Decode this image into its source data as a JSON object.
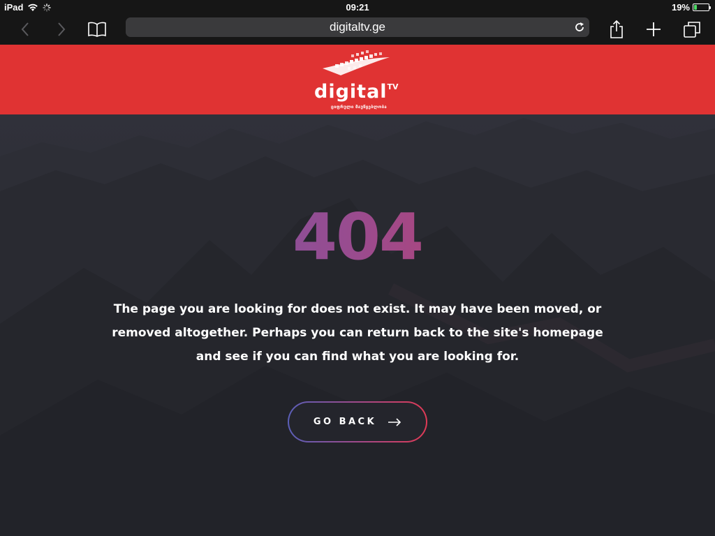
{
  "status_bar": {
    "device": "iPad",
    "time": "09:21",
    "battery_percent": "19%",
    "battery_level": 0.19
  },
  "browser": {
    "url": "digitaltv.ge",
    "icons": {
      "back": "chevron-left-icon",
      "forward": "chevron-right-icon",
      "bookmarks": "book-icon",
      "reload": "reload-icon",
      "share": "share-icon",
      "new_tab": "plus-icon",
      "tabs": "tabs-icon"
    }
  },
  "header": {
    "logo_text": "digital",
    "logo_superscript": "TV",
    "logo_tagline": "ციფრული მაუწყებლობა",
    "background_color": "#e03333"
  },
  "error": {
    "code": "404",
    "message": "The page you are looking for does not exist. It may have been moved, or removed altogether. Perhaps you can return back to the site's homepage and see if you can find what you are looking for.",
    "button_label": "GO BACK",
    "gradient_start": "#5a5fb8",
    "gradient_end": "#e0384e"
  }
}
